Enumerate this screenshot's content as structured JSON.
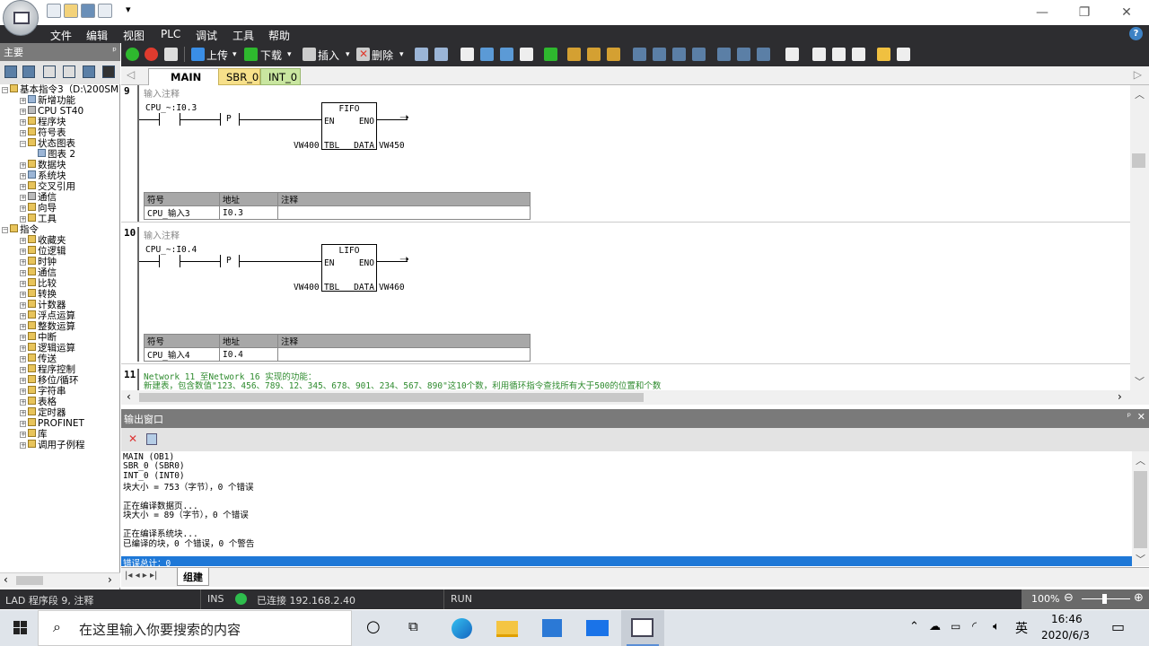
{
  "menu": [
    "文件",
    "编辑",
    "视图",
    "PLC",
    "调试",
    "工具",
    "帮助"
  ],
  "toolbar": {
    "upload": "上传",
    "download": "下载",
    "insert": "插入",
    "delete": "删除"
  },
  "left_panel": {
    "title": "主要",
    "tree": [
      {
        "label": "基本指令3（D:\\200SM",
        "level": 0
      },
      {
        "label": "新增功能",
        "level": 1
      },
      {
        "label": "CPU ST40",
        "level": 1
      },
      {
        "label": "程序块",
        "level": 1
      },
      {
        "label": "符号表",
        "level": 1
      },
      {
        "label": "状态图表",
        "level": 1
      },
      {
        "label": "图表 2",
        "level": 2
      },
      {
        "label": "数据块",
        "level": 1
      },
      {
        "label": "系统块",
        "level": 1
      },
      {
        "label": "交叉引用",
        "level": 1
      },
      {
        "label": "通信",
        "level": 1
      },
      {
        "label": "向导",
        "level": 1
      },
      {
        "label": "工具",
        "level": 1
      },
      {
        "label": "指令",
        "level": 0
      },
      {
        "label": "收藏夹",
        "level": 1
      },
      {
        "label": "位逻辑",
        "level": 1
      },
      {
        "label": "时钟",
        "level": 1
      },
      {
        "label": "通信",
        "level": 1
      },
      {
        "label": "比较",
        "level": 1
      },
      {
        "label": "转换",
        "level": 1
      },
      {
        "label": "计数器",
        "level": 1
      },
      {
        "label": "浮点运算",
        "level": 1
      },
      {
        "label": "整数运算",
        "level": 1
      },
      {
        "label": "中断",
        "level": 1
      },
      {
        "label": "逻辑运算",
        "level": 1
      },
      {
        "label": "传送",
        "level": 1
      },
      {
        "label": "程序控制",
        "level": 1
      },
      {
        "label": "移位/循环",
        "level": 1
      },
      {
        "label": "字符串",
        "level": 1
      },
      {
        "label": "表格",
        "level": 1
      },
      {
        "label": "定时器",
        "level": 1
      },
      {
        "label": "PROFINET",
        "level": 1
      },
      {
        "label": "库",
        "level": 1
      },
      {
        "label": "调用子例程",
        "level": 1
      }
    ]
  },
  "tabs": [
    {
      "label": "MAIN",
      "close": "×",
      "active": true
    },
    {
      "label": "SBR_0",
      "active": false
    },
    {
      "label": "INT_0",
      "active": false
    }
  ],
  "networks": [
    {
      "num": "9",
      "comment": "输入注释",
      "contact": "CPU_~:I0.3",
      "edge": "P",
      "box": "FIFO",
      "en": "EN",
      "eno": "ENO",
      "tbl_in": "VW400",
      "tbl": "TBL",
      "data": "DATA",
      "data_out": "VW450",
      "sym_headers": [
        "符号",
        "地址",
        "注释"
      ],
      "sym_row": [
        "CPU_输入3",
        "I0.3",
        ""
      ]
    },
    {
      "num": "10",
      "comment": "输入注释",
      "contact": "CPU_~:I0.4",
      "edge": "P",
      "box": "LIFO",
      "en": "EN",
      "eno": "ENO",
      "tbl_in": "VW400",
      "tbl": "TBL",
      "data": "DATA",
      "data_out": "VW460",
      "sym_headers": [
        "符号",
        "地址",
        "注释"
      ],
      "sym_row": [
        "CPU_输入4",
        "I0.4",
        ""
      ]
    },
    {
      "num": "11",
      "line1": "Network 11  至Network 16  实现的功能：",
      "line2": "新建表，包含数值\"123、456、789、12、345、678、901、234、567、890\"这10个数，利用循环指令查找所有大于500的位置和个数"
    }
  ],
  "output": {
    "title": "输出窗口",
    "lines": [
      "MAIN (OB1)",
      "SBR_0 (SBR0)",
      "INT_0 (INT0)",
      "块大小 = 753（字节），0 个错误",
      "",
      "正在编译数据页...",
      "块大小 = 89（字节），0 个错误",
      "",
      "正在编译系统块...",
      "已编译的块，0 个错误，0 个警告",
      ""
    ],
    "highlight": "错误总计：0",
    "tab": "组建"
  },
  "status": {
    "mode": "LAD 程序段 9, 注释",
    "ins": "INS",
    "connection": "已连接 192.168.2.40",
    "run": "RUN",
    "zoom": "100%"
  },
  "taskbar": {
    "search_placeholder": "在这里输入你要搜索的内容",
    "lang": "英",
    "time": "16:46",
    "date": "2020/6/3"
  }
}
